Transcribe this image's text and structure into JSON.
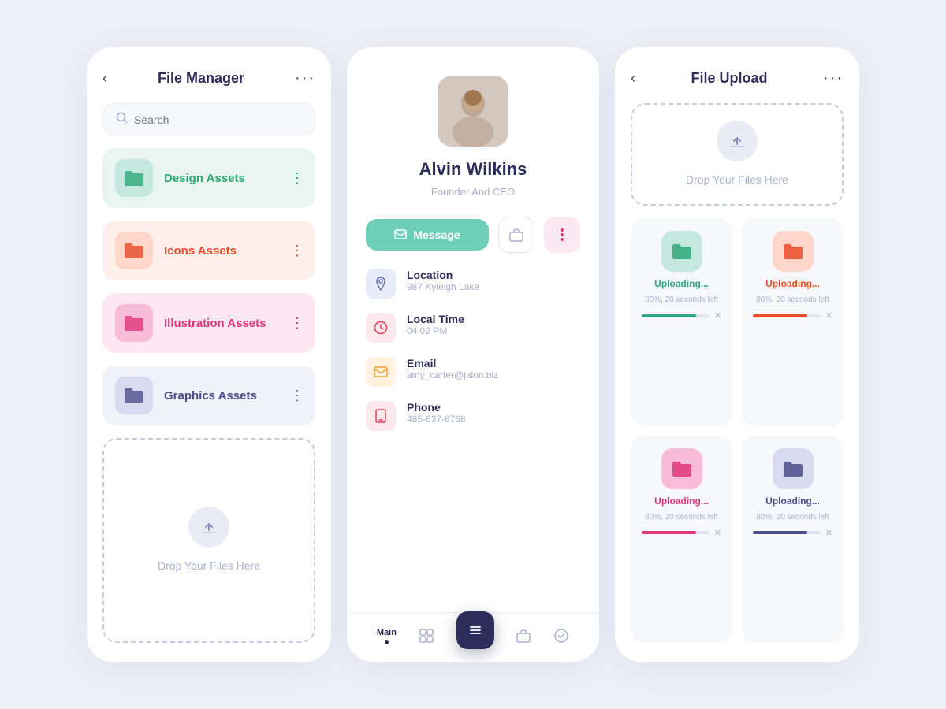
{
  "filemanager": {
    "title": "File Manager",
    "search_placeholder": "Search",
    "folders": [
      {
        "id": "design",
        "label": "Design Assets",
        "color": "design"
      },
      {
        "id": "icons",
        "label": "Icons Assets",
        "color": "icons"
      },
      {
        "id": "illustration",
        "label": "Illustration Assets",
        "color": "illustration"
      },
      {
        "id": "graphics",
        "label": "Graphics Assets",
        "color": "graphics"
      }
    ],
    "drop_zone_text": "Drop Your Files Here"
  },
  "profile": {
    "name": "Alvin Wilkins",
    "role": "Founder And CEO",
    "message_btn": "Message",
    "info": [
      {
        "id": "location",
        "label": "Location",
        "value": "987 Kyleigh Lake"
      },
      {
        "id": "time",
        "label": "Local Time",
        "value": "04:02 PM"
      },
      {
        "id": "email",
        "label": "Email",
        "value": "amy_carter@jalon.biz"
      },
      {
        "id": "phone",
        "label": "Phone",
        "value": "485-637-8768"
      }
    ],
    "nav": [
      {
        "id": "main",
        "label": "Main",
        "active": true
      },
      {
        "id": "grid",
        "label": "",
        "active": false
      },
      {
        "id": "list",
        "label": "",
        "active": false
      },
      {
        "id": "briefcase",
        "label": "",
        "active": false
      },
      {
        "id": "check",
        "label": "",
        "active": false
      }
    ]
  },
  "fileupload": {
    "title": "File Upload",
    "drop_zone_text": "Drop Your Files Here",
    "items": [
      {
        "id": "upl1",
        "status": "Uploading...",
        "detail": "80%, 20 seconds left",
        "color": "teal"
      },
      {
        "id": "upl2",
        "status": "Uploading...",
        "detail": "80%, 20 seconds left",
        "color": "red"
      },
      {
        "id": "upl3",
        "status": "Uploading...",
        "detail": "80%, 20 seconds left",
        "color": "pink"
      },
      {
        "id": "upl4",
        "status": "Uploading...",
        "detail": "80%, 20 seconds left",
        "color": "purple"
      }
    ]
  }
}
